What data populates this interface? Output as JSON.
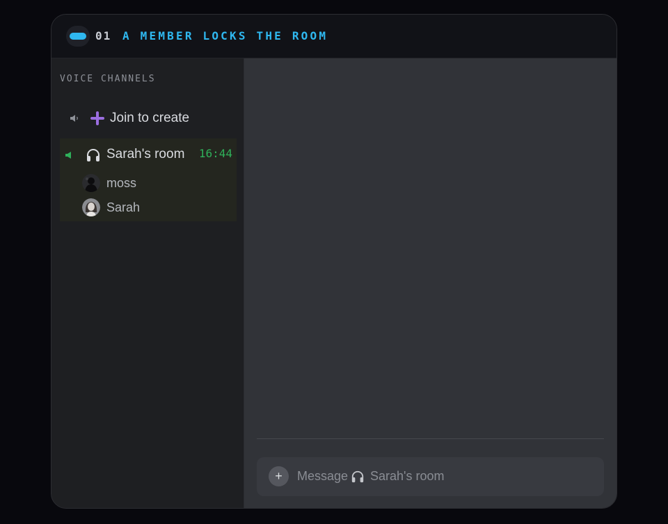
{
  "header": {
    "step_number": "01",
    "step_title": "A MEMBER LOCKS THE ROOM",
    "accent_color": "#2fb8f0"
  },
  "sidebar": {
    "section_title": "VOICE CHANNELS",
    "join_item": {
      "label": "Join to create",
      "icon": "plus-icon",
      "accent_color": "#9b6ee0"
    },
    "room": {
      "label": "Sarah's room",
      "icon": "headphones-icon",
      "timer": "16:44",
      "timer_color": "#2fb05a",
      "members": [
        {
          "name": "moss",
          "avatar": "dark-silhouette-avatar"
        },
        {
          "name": "Sarah",
          "avatar": "portrait-avatar"
        }
      ]
    }
  },
  "composer": {
    "placeholder_prefix": "Message",
    "channel": "Sarah's room",
    "attach_label": "+"
  }
}
